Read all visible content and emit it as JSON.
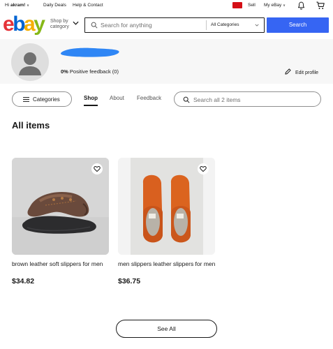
{
  "topbar": {
    "greeting_prefix": "Hi ",
    "username": "akram!",
    "daily_deals": "Daily Deals",
    "help_contact": "Help & Contact",
    "sell": "Sell",
    "my_ebay": "My eBay",
    "flag_color": "#d40f16"
  },
  "header": {
    "logo_letters": [
      "e",
      "b",
      "a",
      "y"
    ],
    "logo_colors": [
      "#e53238",
      "#0064d2",
      "#f5af02",
      "#86b817"
    ],
    "shop_by_line1": "Shop by",
    "shop_by_line2": "category",
    "search_placeholder": "Search for anything",
    "category_select": "All Categories",
    "search_button": "Search",
    "accent": "#3665f3"
  },
  "profile": {
    "feedback_percent": "0%",
    "feedback_text": " Positive feedback (0)",
    "edit_profile": "Edit profile",
    "username_redacted_color": "#2f86f5"
  },
  "store_nav": {
    "categories_button": "Categories",
    "tabs": [
      {
        "label": "Shop",
        "active": true
      },
      {
        "label": "About",
        "active": false
      },
      {
        "label": "Feedback",
        "active": false
      }
    ],
    "search_placeholder": "Search all 2 items"
  },
  "section_title": "All items",
  "items": [
    {
      "title": "brown leather soft slippers for men",
      "price": "$34.82",
      "image": "brown-slipper-photo",
      "favorite_icon": "heart-icon"
    },
    {
      "title": "men slippers leather slippers for men",
      "price": "$36.75",
      "image": "orange-slippers-photo",
      "favorite_icon": "heart-icon"
    }
  ],
  "see_all": "See All",
  "icons": [
    "bell-icon",
    "cart-icon",
    "search-icon",
    "chevron-down-icon",
    "pencil-icon",
    "menu-icon",
    "heart-icon",
    "avatar-icon"
  ]
}
